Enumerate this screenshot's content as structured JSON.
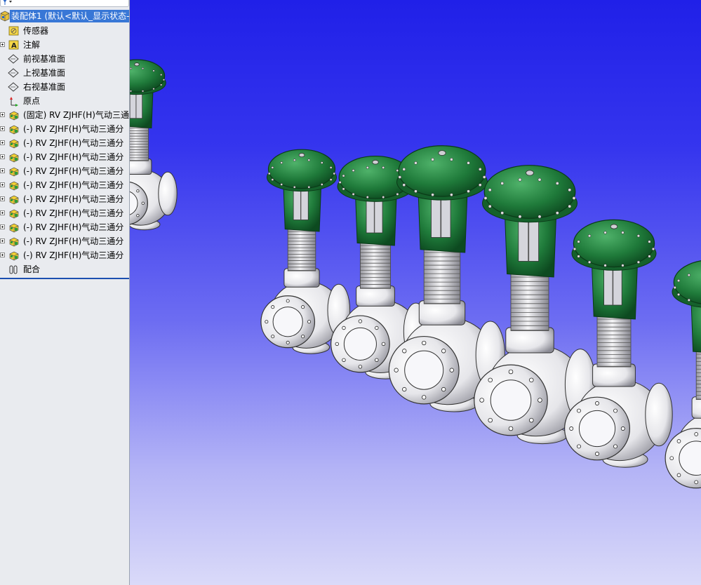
{
  "tree": {
    "root_label": "装配体1 (默认<默认_显示状态-",
    "items": [
      {
        "label": "传感器",
        "icon": "sensor-icon",
        "expandable": false
      },
      {
        "label": "注解",
        "icon": "annotation-icon",
        "expandable": true
      },
      {
        "label": "前视基准面",
        "icon": "plane-icon",
        "expandable": false
      },
      {
        "label": "上视基准面",
        "icon": "plane-icon",
        "expandable": false
      },
      {
        "label": "右视基准面",
        "icon": "plane-icon",
        "expandable": false
      },
      {
        "label": "原点",
        "icon": "origin-icon",
        "expandable": false
      },
      {
        "label": "(固定) RV ZJHF(H)气动三通分",
        "icon": "part-icon",
        "expandable": true
      },
      {
        "label": "(-) RV ZJHF(H)气动三通分",
        "icon": "part-icon",
        "expandable": true
      },
      {
        "label": "(-) RV ZJHF(H)气动三通分",
        "icon": "part-icon",
        "expandable": true
      },
      {
        "label": "(-) RV ZJHF(H)气动三通分",
        "icon": "part-icon",
        "expandable": true
      },
      {
        "label": "(-) RV ZJHF(H)气动三通分",
        "icon": "part-icon",
        "expandable": true
      },
      {
        "label": "(-) RV ZJHF(H)气动三通分",
        "icon": "part-icon",
        "expandable": true
      },
      {
        "label": "(-) RV ZJHF(H)气动三通分",
        "icon": "part-icon",
        "expandable": true
      },
      {
        "label": "(-) RV ZJHF(H)气动三通分",
        "icon": "part-icon",
        "expandable": true
      },
      {
        "label": "(-) RV ZJHF(H)气动三通分",
        "icon": "part-icon",
        "expandable": true
      },
      {
        "label": "(-) RV ZJHF(H)气动三通分",
        "icon": "part-icon",
        "expandable": true
      },
      {
        "label": "(-) RV ZJHF(H)气动三通分",
        "icon": "part-icon",
        "expandable": true
      },
      {
        "label": "配合",
        "icon": "mates-icon",
        "expandable": false
      }
    ]
  },
  "colors": {
    "selection": "#3877d6",
    "viewport_top": "#2020e8",
    "viewport_bottom": "#dadaf9",
    "actuator_green": "#1f7a3a",
    "valve_body": "#e6e6ea"
  },
  "model": {
    "valves": [
      {
        "scale": 0.55
      },
      {
        "scale": 0.66
      },
      {
        "scale": 0.72
      },
      {
        "scale": 0.86
      },
      {
        "scale": 0.9
      },
      {
        "scale": 0.8
      },
      {
        "scale": 0.76
      }
    ]
  }
}
